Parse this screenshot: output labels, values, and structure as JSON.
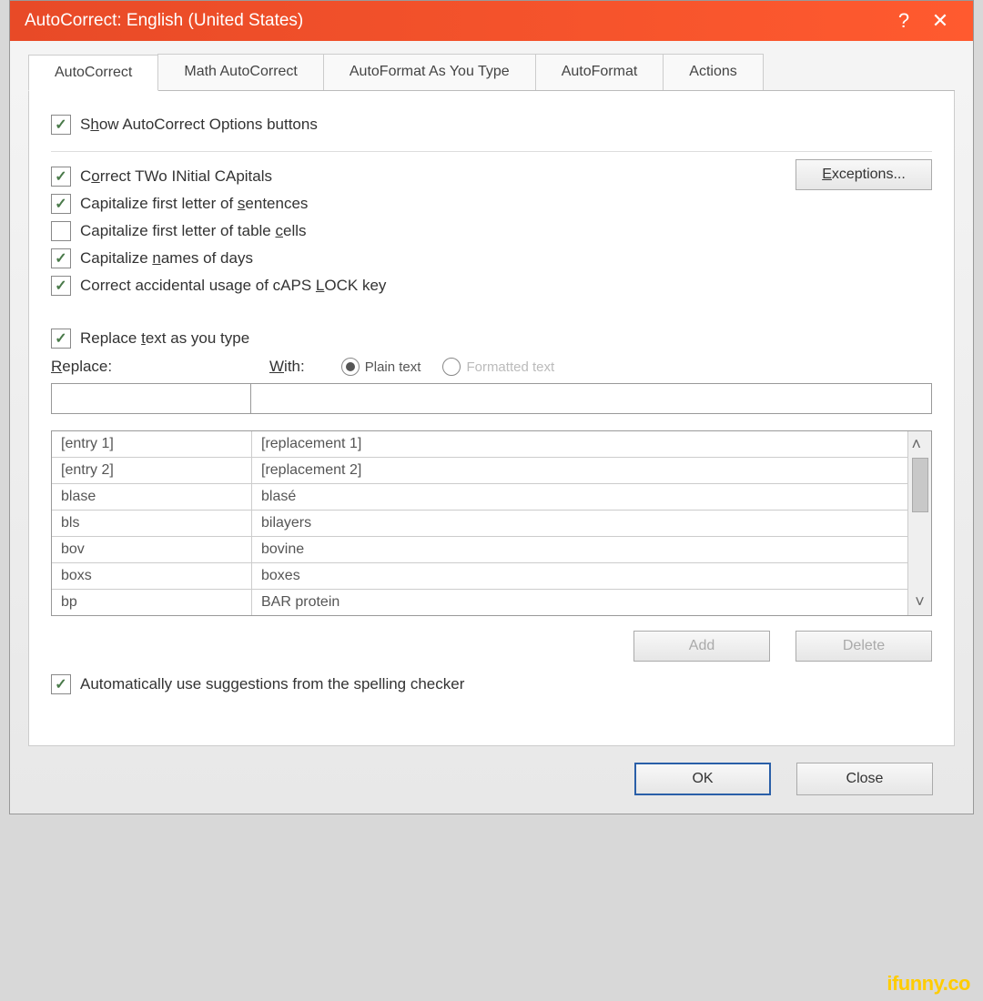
{
  "title": "AutoCorrect: English (United States)",
  "tabs": {
    "autocorrect": "AutoCorrect",
    "math": "Math AutoCorrect",
    "autoformat_type": "AutoFormat As You Type",
    "autoformat": "AutoFormat",
    "actions": "Actions"
  },
  "checkboxes": {
    "show_buttons": "Show AutoCorrect Options buttons",
    "two_initial": "Correct TWo INitial CApitals",
    "cap_sentences": "Capitalize first letter of sentences",
    "cap_cells": "Capitalize first letter of table cells",
    "cap_days": "Capitalize names of days",
    "caps_lock": "Correct accidental usage of cAPS LOCK key",
    "replace_type": "Replace text as you type",
    "auto_suggest": "Automatically use suggestions from the spelling checker"
  },
  "buttons": {
    "exceptions": "Exceptions...",
    "add": "Add",
    "delete": "Delete",
    "ok": "OK",
    "close": "Close"
  },
  "labels": {
    "replace": "Replace:",
    "with": "With:",
    "plain": "Plain text",
    "formatted": "Formatted text"
  },
  "table": [
    {
      "from": "[entry 1]",
      "to": "[replacement 1]"
    },
    {
      "from": "[entry 2]",
      "to": "[replacement 2]"
    },
    {
      "from": "blase",
      "to": "blasé"
    },
    {
      "from": "bls",
      "to": "bilayers"
    },
    {
      "from": "bov",
      "to": "bovine"
    },
    {
      "from": "boxs",
      "to": "boxes"
    },
    {
      "from": "bp",
      "to": "BAR protein"
    }
  ],
  "watermark": "ifunny.co"
}
